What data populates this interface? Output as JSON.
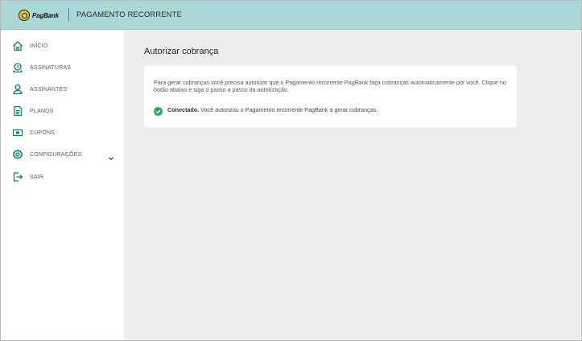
{
  "header": {
    "logo_text": "PagBank",
    "title": "PAGAMENTO RECORRENTE"
  },
  "sidebar": {
    "items": [
      {
        "label": "INÍCIO",
        "icon": "home-icon"
      },
      {
        "label": "ASSINATURAS",
        "icon": "subscriptions-icon"
      },
      {
        "label": "ASSINANTES",
        "icon": "user-icon"
      },
      {
        "label": "PLANOS",
        "icon": "document-icon"
      },
      {
        "label": "CUPONS",
        "icon": "coupon-icon"
      },
      {
        "label": "CONFIGURAÇÕES",
        "icon": "gear-icon"
      },
      {
        "label": "SAIR",
        "icon": "logout-icon"
      }
    ]
  },
  "main": {
    "title": "Autorizar cobrança",
    "description": "Para gerar cobranças você precisa autorizar que o Pagamento recorrente PagBank faça cobranças automaticamente por você. Clique no botão abaixo e siga o passo a passo da autorização.",
    "status_label": "Conectado.",
    "status_text": " Você autorizou o Pagamento recorrente PagBank a gerar cobranças."
  },
  "colors": {
    "header_bg": "#a9d8d6",
    "accent": "#0a7f74",
    "success": "#2eaa5e",
    "main_bg": "#eeeeee"
  }
}
